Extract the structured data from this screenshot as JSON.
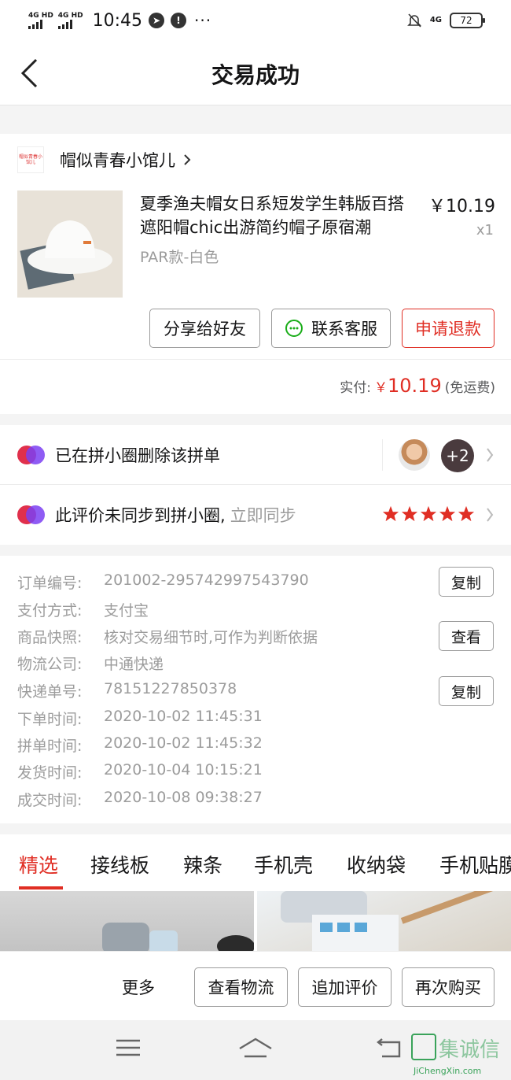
{
  "status_bar": {
    "sim1": "4G HD",
    "sim2": "4G HD",
    "time": "10:45",
    "notif_icon": "!",
    "more": "···",
    "network": "4G",
    "battery": "72"
  },
  "nav": {
    "title": "交易成功"
  },
  "shop": {
    "logo_text": "帽似青春小馆儿",
    "name": "帽似青春小馆儿"
  },
  "product": {
    "title": "夏季渔夫帽女日系短发学生韩版百搭遮阳帽chic出游简约帽子原宿潮",
    "spec": "PAR款-白色",
    "price": "￥10.19",
    "qty": "x1"
  },
  "actions": {
    "share": "分享给好友",
    "service": "联系客服",
    "refund": "申请退款"
  },
  "payment": {
    "label": "实付:",
    "yen": "￥",
    "amount": "10.19",
    "note": "(免运费)"
  },
  "circle": {
    "row1_text": "已在拼小圈删除该拼单",
    "extra_count": "+2",
    "row2_text": "此评价未同步到拼小圈,",
    "row2_link": "立即同步",
    "rating": 5
  },
  "order_info": [
    {
      "label": "订单编号:",
      "value": "201002-295742997543790",
      "button": "复制"
    },
    {
      "label": "支付方式:",
      "value": "支付宝",
      "button": ""
    },
    {
      "label": "商品快照:",
      "value": "核对交易细节时,可作为判断依据",
      "button": "查看"
    },
    {
      "label": "物流公司:",
      "value": "中通快递",
      "button": ""
    },
    {
      "label": "快递单号:",
      "value": "78151227850378",
      "button": "复制"
    },
    {
      "label": "下单时间:",
      "value": "2020-10-02 11:45:31",
      "button": ""
    },
    {
      "label": "拼单时间:",
      "value": "2020-10-02 11:45:32",
      "button": ""
    },
    {
      "label": "发货时间:",
      "value": "2020-10-04 10:15:21",
      "button": ""
    },
    {
      "label": "成交时间:",
      "value": "2020-10-08 09:38:27",
      "button": ""
    }
  ],
  "tabs": [
    "精选",
    "接线板",
    "辣条",
    "手机壳",
    "收纳袋",
    "手机贴膜"
  ],
  "bottom_actions": {
    "more": "更多",
    "logistics": "查看物流",
    "add_review": "追加评价",
    "buy_again": "再次购买"
  },
  "watermark": {
    "text": "集诚信",
    "url": "JiChengXin.com"
  },
  "colors": {
    "accent": "#e02e24",
    "text": "#151516",
    "muted": "#9c9c9c"
  }
}
